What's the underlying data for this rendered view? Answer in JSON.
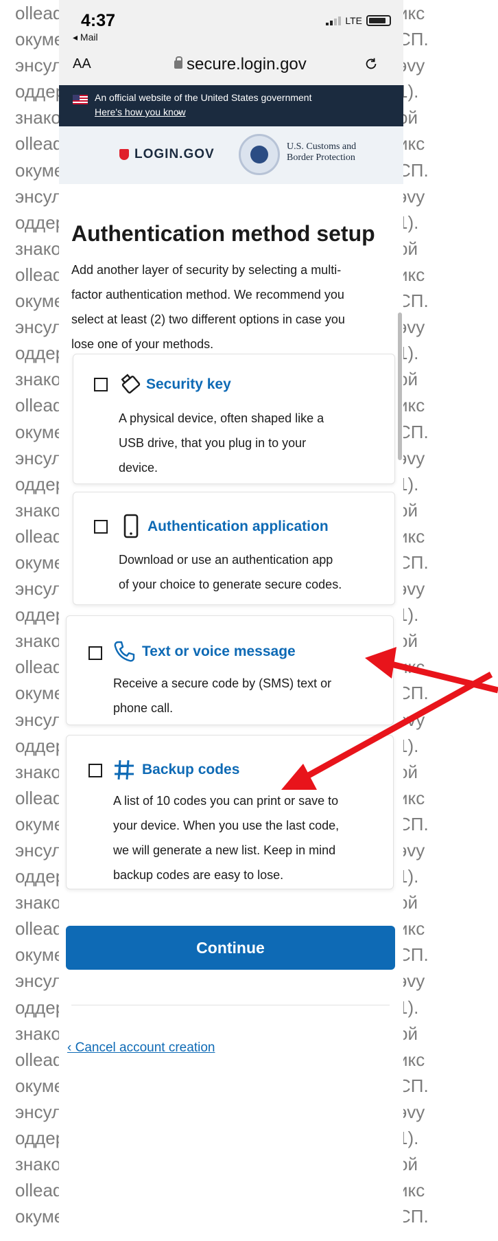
{
  "background": {
    "left_fragments": [
      "olleaq",
      "окуме",
      "энсул",
      "оддер",
      "знако",
      "olleaq",
      "окуме",
      "энсул",
      "оддер",
      "знако",
      "olleaq",
      "окуме",
      "энсул",
      "оддер",
      "знако",
      "olleaq",
      "окуме",
      "энсул",
      "оддер",
      "знако",
      "olleaq",
      "окуме",
      "энсул",
      "оддер",
      "знако",
      "olleaq",
      "окуме",
      "энсул",
      "оддер",
      "знако",
      "olleaq",
      "окуме",
      "энсул",
      "оддер",
      "знако",
      "olleaq",
      "окуме",
      "энсул",
      "оддер",
      "знако",
      "olleaq",
      "окуме",
      "энсул",
      "оддер",
      "знако",
      "olleaq",
      "окуме"
    ],
    "right_fragments": [
      "икс",
      "СП.",
      "эvy",
      "1).",
      "ой",
      "икс",
      "СП.",
      "эvy",
      "1).",
      "ой",
      "икс",
      "СП.",
      "эvy",
      "1).",
      "ой",
      "икс",
      "СП.",
      "эvy",
      "1).",
      "ой",
      "икс",
      "СП.",
      "эvy",
      "1).",
      "ой",
      "икс",
      "СП.",
      "эvy",
      "1).",
      "ой",
      "икс",
      "СП.",
      "эvy",
      "1).",
      "ой",
      "икс",
      "СП.",
      "эvy",
      "1).",
      "ой",
      "икс",
      "СП.",
      "эvy",
      "1).",
      "ой",
      "икс",
      "СП."
    ]
  },
  "status_bar": {
    "time": "4:37",
    "back_label": "◂ Mail",
    "network": "LTE"
  },
  "browser": {
    "text_size_label": "AA",
    "url": "secure.login.gov"
  },
  "gov_banner": {
    "text": "An official website of the United States government",
    "link": "Here's how you know"
  },
  "header": {
    "login_logo": "LOGIN.GOV",
    "partner_line1": "U.S. Customs and",
    "partner_line2": "Border Protection"
  },
  "page": {
    "title": "Authentication method setup",
    "intro_lines": [
      "Add another layer of security by selecting a multi-",
      "factor authentication method. We recommend you",
      "select at least (2) two different options in case you",
      "lose one of your methods."
    ]
  },
  "options": [
    {
      "title": "Security key",
      "icon": "security-key-icon",
      "checked": false,
      "desc_lines": [
        "A physical device, often shaped like a",
        "USB drive, that you plug in to your",
        "device."
      ]
    },
    {
      "title": "Authentication application",
      "icon": "phone-app-icon",
      "checked": false,
      "desc_lines": [
        "Download or use an authentication app",
        "of your choice to generate secure codes."
      ]
    },
    {
      "title": "Text or voice message",
      "icon": "phone-call-icon",
      "checked": false,
      "desc_lines": [
        "Receive a secure code by (SMS) text or",
        "phone call."
      ]
    },
    {
      "title": "Backup codes",
      "icon": "backup-codes-icon",
      "checked": false,
      "desc_lines": [
        "A list of 10 codes you can print or save to",
        "your device. When you use the last code,",
        "we will generate a new list. Keep in mind",
        "backup codes are easy to lose."
      ]
    }
  ],
  "actions": {
    "continue": "Continue",
    "cancel": "‹ Cancel account creation"
  },
  "colors": {
    "primary": "#0e6ab5",
    "gov_banner": "#1b2b3f",
    "annotation_arrow": "#e8141b"
  }
}
